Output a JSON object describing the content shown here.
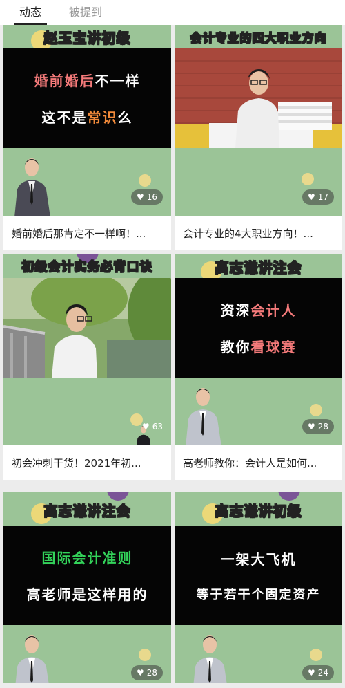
{
  "tabs": [
    {
      "label": "动态",
      "active": true
    },
    {
      "label": "被提到",
      "active": false
    }
  ],
  "cards": [
    {
      "badge": "赵玉宝讲初级",
      "line1_a": "婚前婚后",
      "line1_b": "不一样",
      "line2_a": "这不是",
      "line2_b": "常识",
      "line2_c": "么",
      "likes": "16",
      "caption": "婚前婚后那肯定不一样啊！..."
    },
    {
      "badge": "会计专业的四大职业方向",
      "likes": "17",
      "caption": "会计专业的4大职业方向！..."
    },
    {
      "badge": "初级会计实务必背口诀",
      "likes": "63",
      "caption": "初会冲刺干货！2021年初..."
    },
    {
      "badge": "高志谦讲注会",
      "line1_a": "资深",
      "line1_b": "会计人",
      "line2_a": "教你",
      "line2_b": "看球赛",
      "likes": "28",
      "caption": "高老师教你：会计人是如何..."
    },
    {
      "badge": "高志谦讲注会",
      "line1": "国际会计准则",
      "line2": "高老师是这样用的",
      "likes": "28",
      "caption": ""
    },
    {
      "badge": "高志谦讲初级",
      "line1": "一架大飞机",
      "line2": "等于若干个固定资产",
      "likes": "24",
      "caption": ""
    }
  ],
  "colors": {
    "thumb_bg": "#9bc497",
    "panel_bg": "#050505",
    "accent_pink": "#f47a7a",
    "accent_orange": "#f28a3a",
    "accent_green": "#33d35a"
  }
}
